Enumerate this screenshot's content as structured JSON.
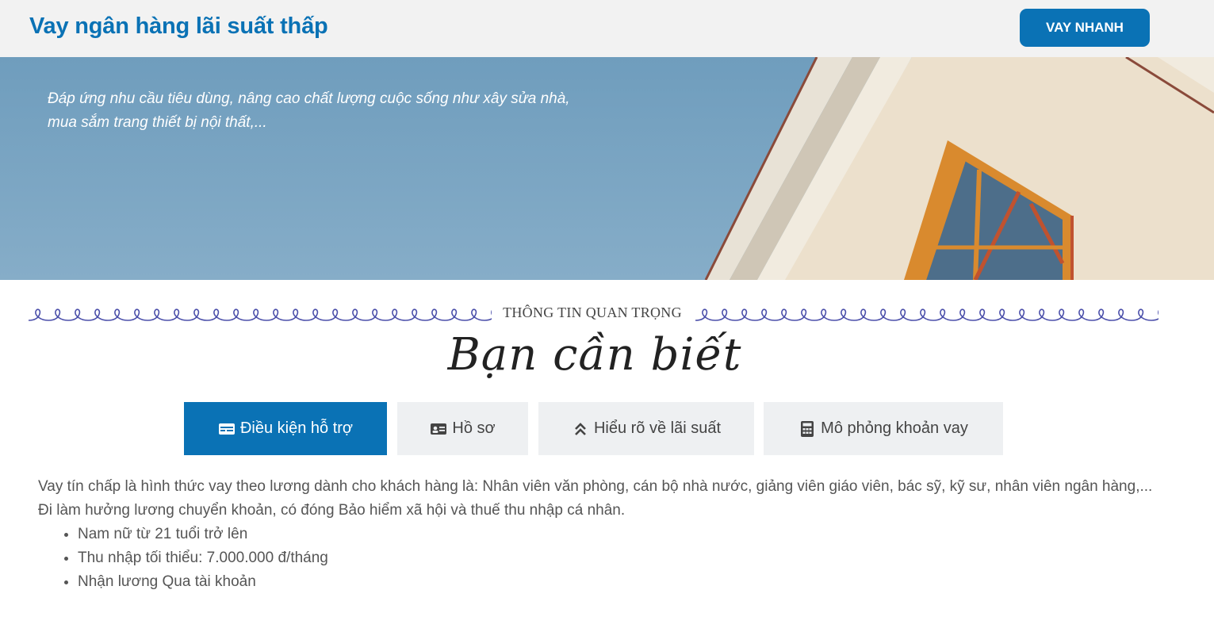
{
  "header": {
    "title": "Vay ngân hàng lãi suất thấp",
    "cta_label": "VAY NHANH",
    "brand_color": "#0a72b5"
  },
  "hero": {
    "tagline": "Đáp ứng nhu cầu tiêu dùng, nâng cao chất lượng cuộc sống như xây sửa nhà, mua sắm trang thiết bị nội thất,..."
  },
  "section": {
    "kicker": "THÔNG TIN QUAN TRỌNG",
    "title": "Bạn cần biết"
  },
  "tabs": [
    {
      "label": "Điều kiện hỗ trợ",
      "icon": "id-card-icon",
      "active": true
    },
    {
      "label": "Hồ sơ",
      "icon": "profile-card-icon",
      "active": false
    },
    {
      "label": "Hiểu rõ về lãi suất",
      "icon": "double-chevron-up-icon",
      "active": false
    },
    {
      "label": "Mô phỏng khoản vay",
      "icon": "calculator-icon",
      "active": false
    }
  ],
  "content": {
    "paragraph1": "Vay tín chấp là hình thức vay theo lương dành cho khách hàng là: Nhân viên văn phòng, cán bộ nhà nước, giảng viên giáo viên, bác sỹ, kỹ sư, nhân viên ngân hàng,...",
    "paragraph2": "Đi làm hưởng lương chuyển khoản, có đóng Bảo hiểm xã hội và thuế thu nhập cá nhân.",
    "bullets": [
      "Nam nữ từ 21 tuổi trở lên",
      "Thu nhập tối thiểu: 7.000.000 đ/tháng",
      "Nhận lương Qua tài khoản"
    ]
  }
}
